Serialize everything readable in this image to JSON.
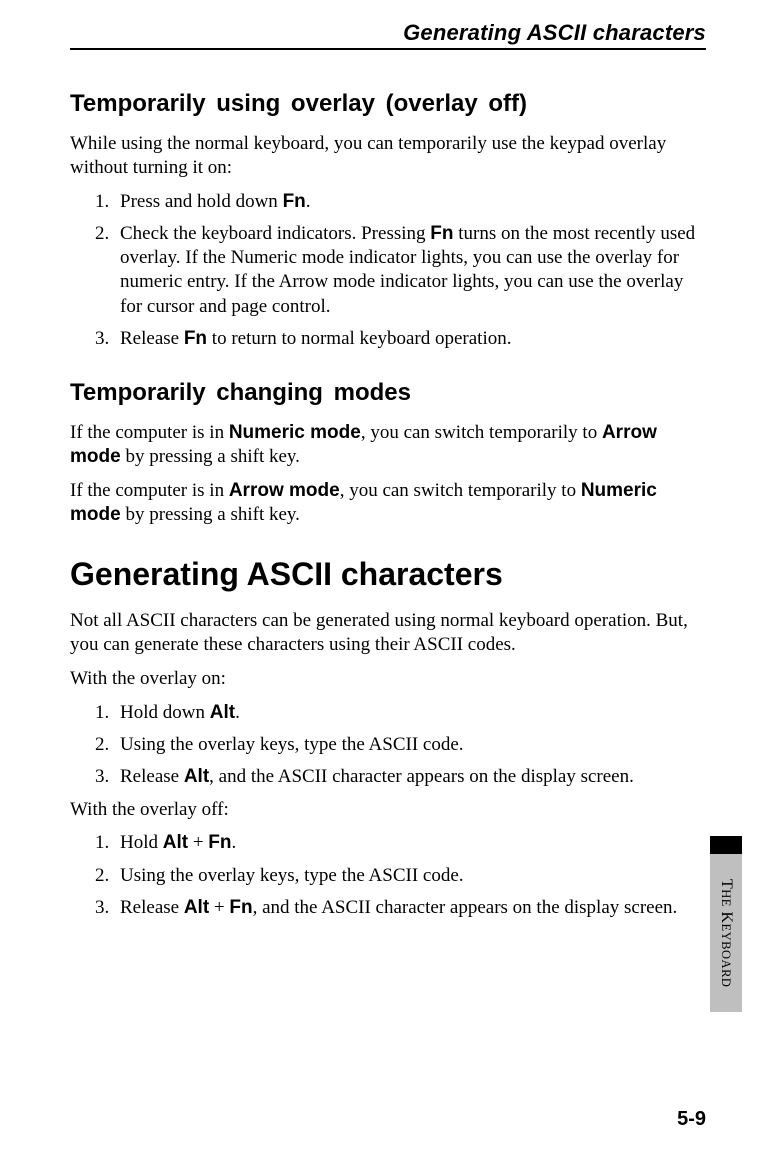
{
  "runningHead": "Generating ASCII characters",
  "section1": {
    "title": "Temporarily using overlay (overlay off)",
    "intro": "While using the normal keyboard, you can temporarily use the keypad overlay without turning it on:",
    "steps": {
      "s1a": "Press and hold down ",
      "s1key": "Fn",
      "s1b": ".",
      "s2a": "Check the keyboard indicators. Pressing ",
      "s2key": "Fn",
      "s2b": " turns on the most recently used overlay. If the Numeric mode indicator lights, you can use the overlay for numeric entry. If the Arrow mode indicator lights, you can use the overlay for cursor and page control.",
      "s3a": "Release ",
      "s3key": "Fn",
      "s3b": " to return to normal keyboard operation."
    }
  },
  "section2": {
    "title": "Temporarily changing modes",
    "p1a": "If the computer is in ",
    "p1b": "Numeric mode",
    "p1c": ", you can switch temporarily to ",
    "p1d": "Arrow mode",
    "p1e": " by pressing a shift key.",
    "p2a": "If the computer is in ",
    "p2b": "Arrow mode",
    "p2c": ", you can switch temporarily to ",
    "p2d": "Numeric mode",
    "p2e": " by pressing a shift key."
  },
  "section3": {
    "title": "Generating ASCII characters",
    "intro": "Not all ASCII characters can be generated using normal keyboard operation. But, you can generate these characters using their ASCII codes.",
    "onLabel": "With the overlay on:",
    "onSteps": {
      "s1a": "Hold down ",
      "s1key": "Alt",
      "s1b": ".",
      "s2": "Using the overlay keys, type the ASCII code.",
      "s3a": "Release ",
      "s3key": "Alt",
      "s3b": ", and the ASCII character appears on the display screen."
    },
    "offLabel": "With the overlay off:",
    "offSteps": {
      "s1a": "Hold ",
      "s1k1": "Alt",
      "s1plus": " + ",
      "s1k2": "Fn",
      "s1b": ".",
      "s2": "Using the overlay keys, type the ASCII code.",
      "s3a": "Release ",
      "s3k1": "Alt",
      "s3plus": " + ",
      "s3k2": "Fn",
      "s3b": ", and the ASCII character appears on the display screen."
    }
  },
  "tab": {
    "t1": "T",
    "t1sc": "HE",
    "space": " ",
    "k1": "K",
    "k1sc": "EYBOARD"
  },
  "pageNumber": "5-9"
}
